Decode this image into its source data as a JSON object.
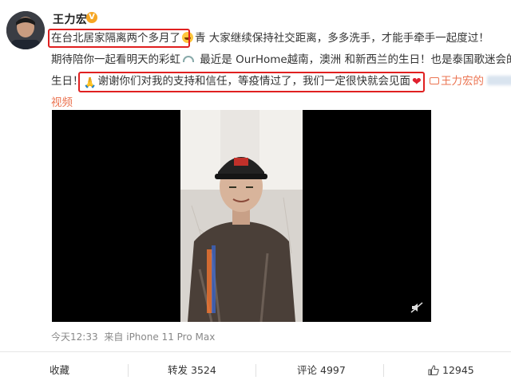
{
  "post": {
    "username": "王力宏",
    "verified_badge": "V",
    "line1": {
      "highlight": "在台北居家隔离两个多月了",
      "rest": "青 大家继续保持社交距离，多多洗手，才能手牵手一起度过！"
    },
    "line2": {
      "part1": "期待陪你一起看明天的彩虹",
      "part2": " 最近是 OurHome越南，澳洲 和新西兰的生日！也是泰国歌迷会的"
    },
    "line3": {
      "part1": "生日！",
      "highlight": "谢谢你们对我的支持和信任，等疫情过了，我们一定很快就会见面",
      "video_link": "王力宏的"
    },
    "line4": {
      "text": "视频"
    }
  },
  "meta": {
    "time": "今天12:33",
    "source": "来自 iPhone 11 Pro Max"
  },
  "actions": {
    "favorite": "收藏",
    "repost_label": "转发",
    "repost_count": "3524",
    "comment_label": "评论",
    "comment_count": "4997",
    "like_count": "12945"
  },
  "icons": {
    "emoji": "grin-emoji-icon",
    "rainbow": "rainbow-icon",
    "pray": "pray-icon",
    "heart": "red-heart-icon",
    "video": "video-link-icon",
    "mute": "mute-icon",
    "like": "thumbs-up-icon"
  },
  "colors": {
    "highlight_box": "#e02020",
    "link": "#eb7350",
    "verified": "#f6a623",
    "video_bg": "#000000"
  }
}
